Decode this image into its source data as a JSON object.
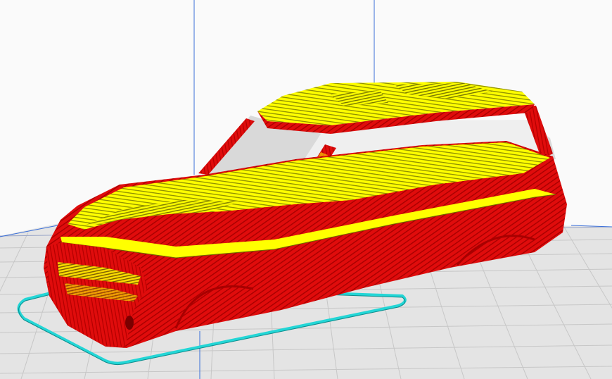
{
  "viewport": {
    "background": "#fafafa",
    "build_plate_color": "#e4e4e4",
    "build_plate_grid_color": "#c7c7c7",
    "volume_edge_color": "#3a6fd8"
  },
  "layer_view": {
    "legend_colors": {
      "wall_outer": "#e00c0c",
      "wall_inner_dark": "#a80000",
      "skin": "#ffff00",
      "skin_dark": "#8c8c00",
      "skirt": "#23d6d6",
      "window_openings": "#d9d9d9"
    }
  }
}
